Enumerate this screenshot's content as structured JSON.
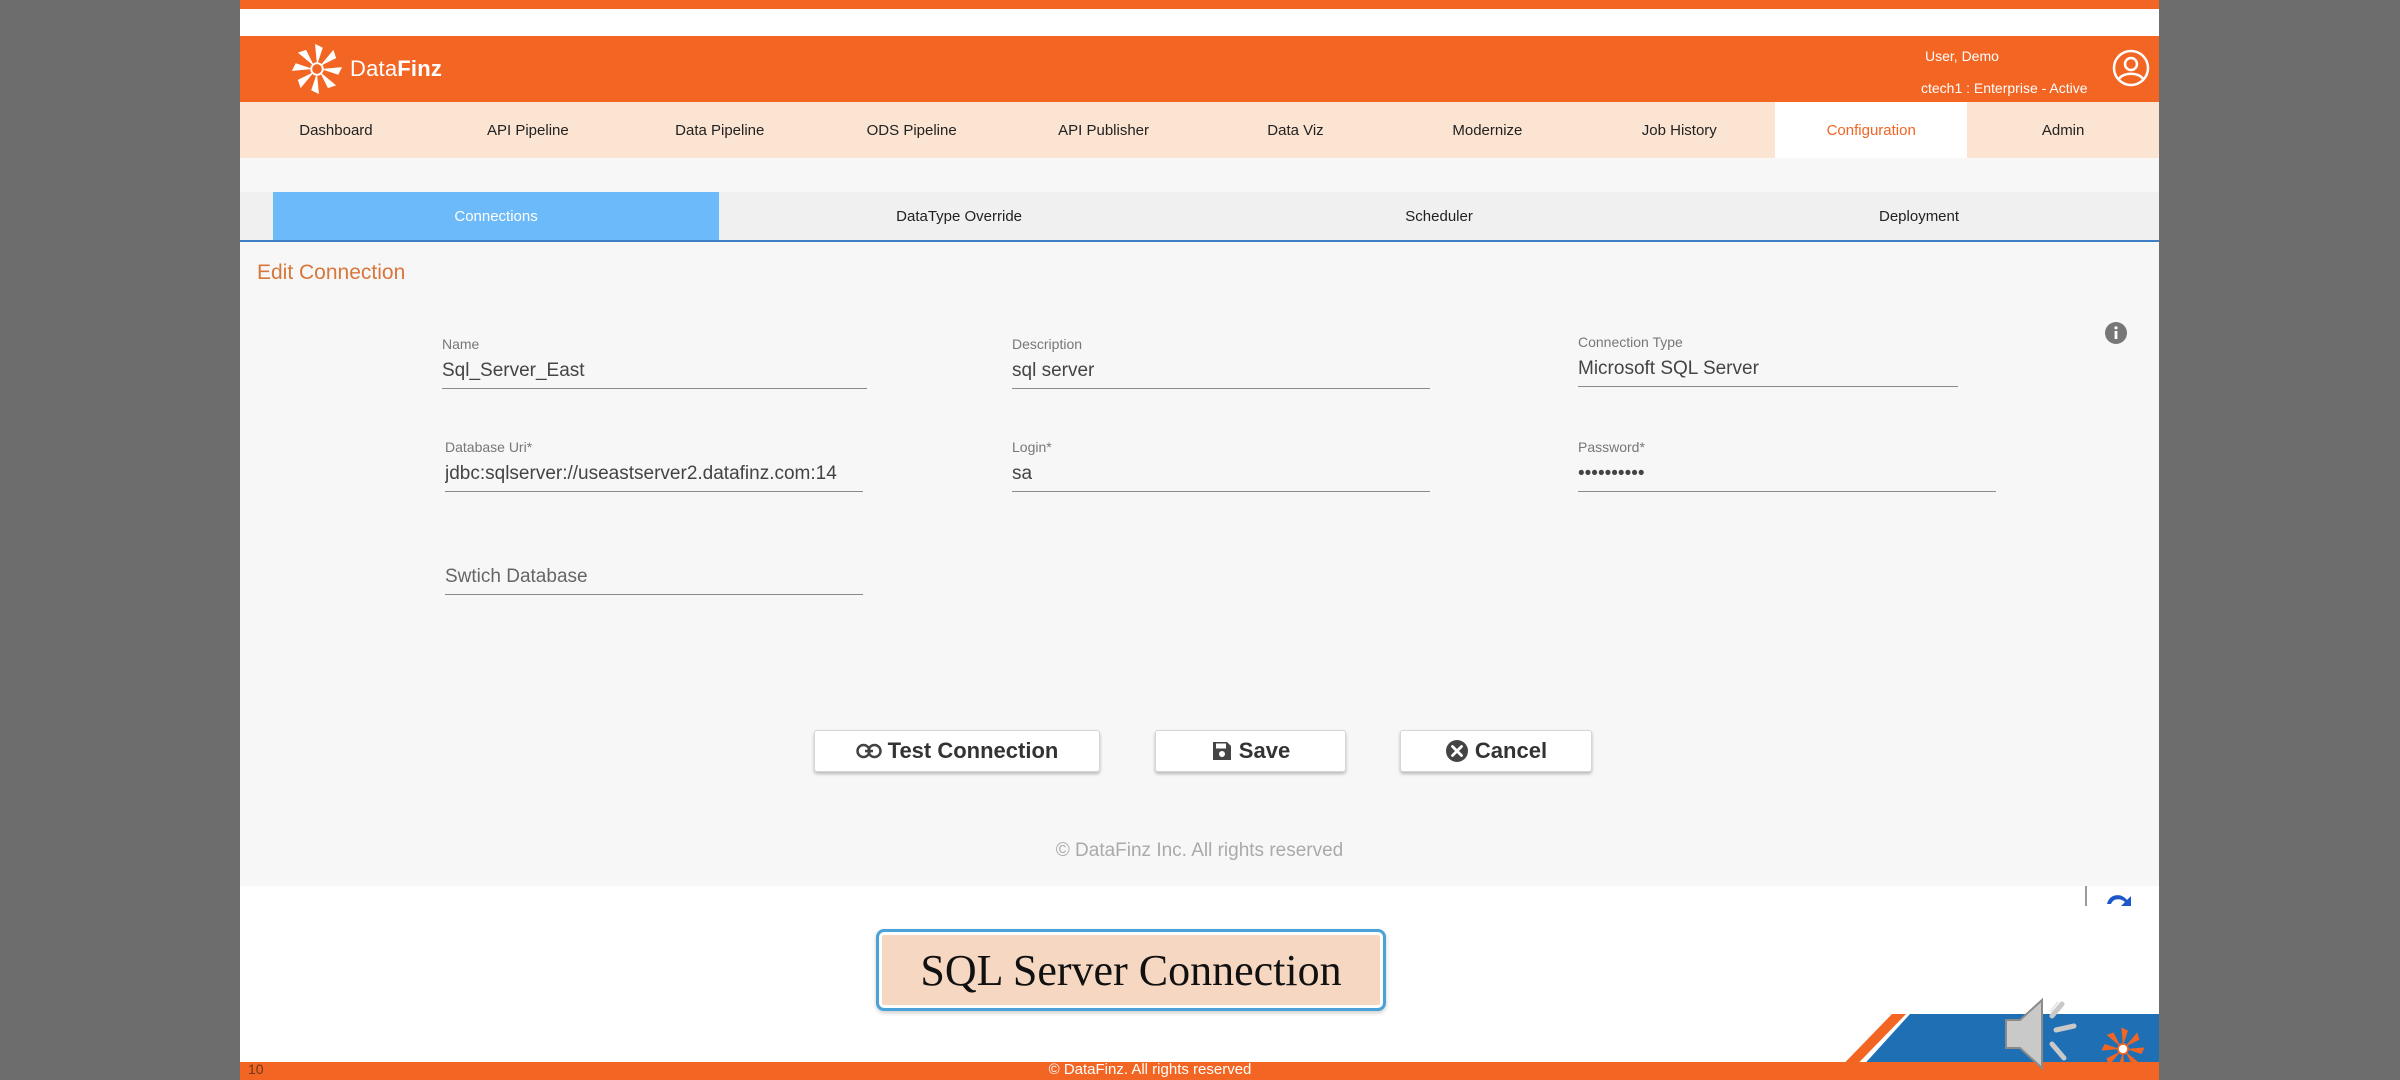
{
  "header": {
    "logo_prefix": "Data",
    "logo_suffix": "Finz",
    "user_name": "User, Demo",
    "user_plan": "ctech1 : Enterprise - Active"
  },
  "nav": {
    "items": [
      {
        "label": "Dashboard"
      },
      {
        "label": "API Pipeline"
      },
      {
        "label": "Data Pipeline"
      },
      {
        "label": "ODS Pipeline"
      },
      {
        "label": "API Publisher"
      },
      {
        "label": "Data Viz"
      },
      {
        "label": "Modernize"
      },
      {
        "label": "Job History"
      },
      {
        "label": "Configuration",
        "active": true
      },
      {
        "label": "Admin"
      }
    ]
  },
  "sub_tabs": {
    "items": [
      {
        "label": "Connections",
        "active": true
      },
      {
        "label": "DataType Override"
      },
      {
        "label": "Scheduler"
      },
      {
        "label": "Deployment"
      }
    ]
  },
  "form": {
    "title": "Edit Connection",
    "name": {
      "label": "Name",
      "value": "Sql_Server_East"
    },
    "description": {
      "label": "Description",
      "value": "sql server"
    },
    "connection_type": {
      "label": "Connection Type",
      "value": "Microsoft SQL Server"
    },
    "database_uri": {
      "label": "Database Uri*",
      "value": "jdbc:sqlserver://useastserver2.datafinz.com:14"
    },
    "login": {
      "label": "Login*",
      "value": "sa"
    },
    "password": {
      "label": "Password*",
      "value": "••••••••••"
    },
    "switch_database": {
      "placeholder": "Swtich Database"
    }
  },
  "buttons": {
    "test_connection": "Test Connection",
    "save": "Save",
    "cancel": "Cancel"
  },
  "footer": {
    "copyright": "© DataFinz Inc. All rights reserved"
  },
  "slide": {
    "caption": "SQL Server Connection",
    "number": "10",
    "copyright": "© DataFinz. All rights reserved"
  },
  "colors": {
    "brand_orange": "#f26522",
    "nav_background": "#fbe4d2",
    "active_tab_blue": "#6cbaf9",
    "title_orange": "#d8763c"
  }
}
